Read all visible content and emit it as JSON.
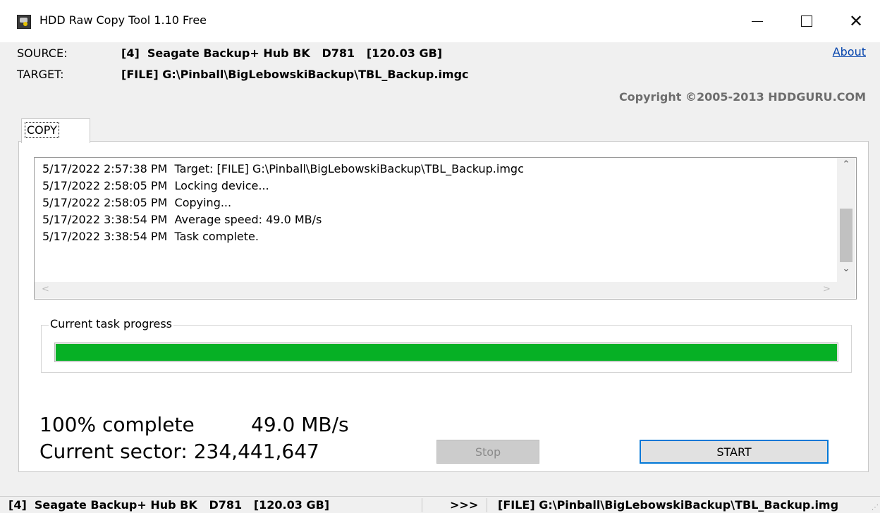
{
  "window": {
    "title": "HDD Raw Copy Tool 1.10   Free"
  },
  "header": {
    "source_label": "SOURCE:",
    "source_value": "[4]  Seagate Backup+ Hub BK   D781   [120.03 GB]",
    "target_label": "TARGET:",
    "target_value": "[FILE] G:\\Pinball\\BigLebowskiBackup\\TBL_Backup.imgc",
    "about_link": "About",
    "copyright": "Copyright ©2005-2013 HDDGURU.COM"
  },
  "tabs": [
    {
      "label": "COPY",
      "selected": true
    }
  ],
  "log": {
    "lines": [
      "5/17/2022 2:57:38 PM  Target: [FILE] G:\\Pinball\\BigLebowskiBackup\\TBL_Backup.imgc",
      "5/17/2022 2:58:05 PM  Locking device...",
      "5/17/2022 2:58:05 PM  Copying...",
      "5/17/2022 3:38:54 PM  Average speed: 49.0 MB/s",
      "5/17/2022 3:38:54 PM  Task complete."
    ]
  },
  "progress": {
    "legend": "Current task progress",
    "fraction": 1.0,
    "fill_color": "#06b025"
  },
  "stats": {
    "complete": "100% complete",
    "speed": "49.0 MB/s",
    "sector": "Current sector: 234,441,647"
  },
  "buttons": {
    "stop": "Stop",
    "start": "START"
  },
  "statusbar": {
    "source": "[4]  Seagate Backup+ Hub BK   D781   [120.03 GB]",
    "arrow": ">>>",
    "target": "[FILE] G:\\Pinball\\BigLebowskiBackup\\TBL_Backup.img"
  },
  "icons": {
    "app": "hdd-app-icon",
    "minimize": "minimize-icon",
    "maximize": "maximize-icon",
    "close": "close-icon",
    "scroll_up": "chevron-up-icon",
    "scroll_down": "chevron-down-icon",
    "scroll_left": "chevron-left-icon",
    "scroll_right": "chevron-right-icon"
  }
}
